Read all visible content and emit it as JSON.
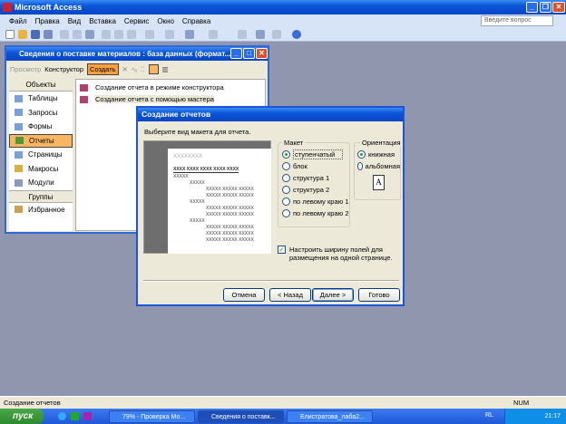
{
  "app": {
    "title": "Microsoft Access",
    "help_placeholder": "Введите вопрос"
  },
  "menu": [
    "Файл",
    "Правка",
    "Вид",
    "Вставка",
    "Сервис",
    "Окно",
    "Справка"
  ],
  "db_window": {
    "title": "Сведения о поставке материалов : база данных (формат...",
    "toolbar": {
      "preview": "Просмотр",
      "design": "Конструктор",
      "create": "Создать"
    },
    "objects_header": "Объекты",
    "objects": [
      "Таблицы",
      "Запросы",
      "Формы",
      "Отчеты",
      "Страницы",
      "Макросы",
      "Модули"
    ],
    "selected_object": "Отчеты",
    "groups_header": "Группы",
    "groups": [
      "Избранное"
    ],
    "list": [
      "Создание отчета в режиме конструктора",
      "Создание отчета с помощью мастера"
    ]
  },
  "dialog": {
    "title": "Создание отчетов",
    "prompt": "Выберите вид макета для отчета.",
    "preview": {
      "title": "XXXXXXXX",
      "header": "XXXX  XXXX  XXXX  XXXX  XXXX",
      "group": "XXXXX",
      "row": "XXXXX  XXXXX  XXXXX"
    },
    "layout_label": "Макет",
    "layouts": [
      "ступенчатый",
      "блок",
      "структура 1",
      "структура 2",
      "по левому краю 1",
      "по левому краю 2"
    ],
    "selected_layout": "ступенчатый",
    "orientation_label": "Ориентация",
    "orientations": [
      "книжная",
      "альбомная"
    ],
    "selected_orientation": "книжная",
    "orientation_icon_letter": "A",
    "checkbox_label": "Настроить ширину полей для размещения на одной странице.",
    "checkbox_checked": true,
    "buttons": {
      "cancel": "Отмена",
      "back": "< Назад",
      "next": "Далее >",
      "finish": "Готово"
    }
  },
  "status": {
    "text": "Создание отчетов",
    "num": "NUM"
  },
  "taskbar": {
    "start": "пуск",
    "tasks": [
      "79% - Проверка Мо...",
      "Сведения о поставк...",
      "Елистратова_лаба2..."
    ],
    "lang": "RL",
    "time": "21:17"
  }
}
